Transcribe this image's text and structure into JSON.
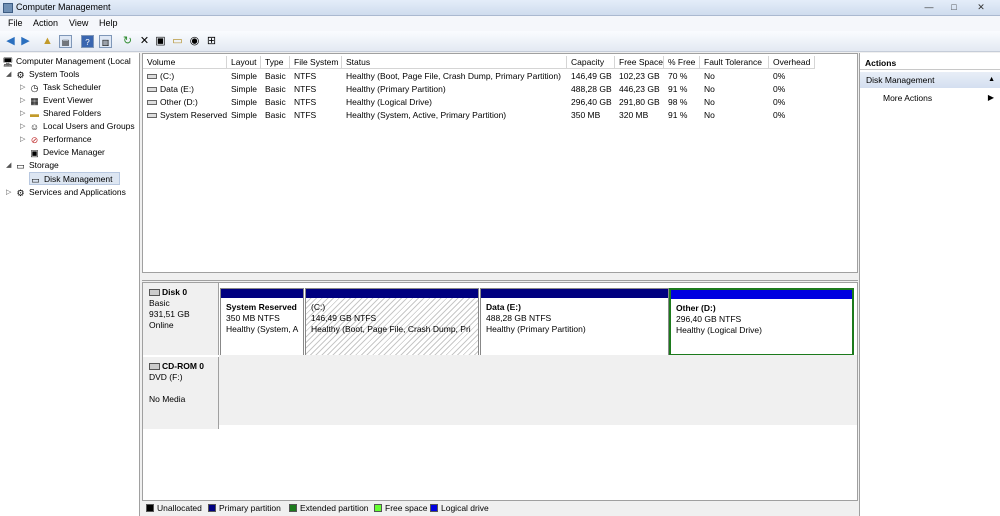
{
  "window": {
    "title": "Computer Management",
    "minimize": "—",
    "maximize": "□",
    "close": "✕"
  },
  "menu": [
    "File",
    "Action",
    "View",
    "Help"
  ],
  "toolbar": {
    "icons": [
      "back-arrow-icon",
      "forward-arrow-icon",
      "up-folder-icon",
      "show-hide-tree-icon",
      "help-icon",
      "show-hide-action-pane-icon",
      "refresh-icon",
      "delete-icon",
      "properties-icon",
      "open-icon",
      "search-icon",
      "zoom-icon"
    ]
  },
  "tree": {
    "root": "Computer Management (Local",
    "system_tools": "System Tools",
    "task_scheduler": "Task Scheduler",
    "event_viewer": "Event Viewer",
    "shared_folders": "Shared Folders",
    "local_users": "Local Users and Groups",
    "performance": "Performance",
    "device_manager": "Device Manager",
    "storage": "Storage",
    "disk_management": "Disk Management",
    "services": "Services and Applications"
  },
  "volumes": {
    "headers": [
      "Volume",
      "Layout",
      "Type",
      "File System",
      "Status",
      "Capacity",
      "Free Space",
      "% Free",
      "Fault Tolerance",
      "Overhead"
    ],
    "rows": [
      [
        "(C:)",
        "Simple",
        "Basic",
        "NTFS",
        "Healthy (Boot, Page File, Crash Dump, Primary Partition)",
        "146,49 GB",
        "102,23 GB",
        "70 %",
        "No",
        "0%"
      ],
      [
        "Data (E:)",
        "Simple",
        "Basic",
        "NTFS",
        "Healthy (Primary Partition)",
        "488,28 GB",
        "446,23 GB",
        "91 %",
        "No",
        "0%"
      ],
      [
        "Other (D:)",
        "Simple",
        "Basic",
        "NTFS",
        "Healthy (Logical Drive)",
        "296,40 GB",
        "291,80 GB",
        "98 %",
        "No",
        "0%"
      ],
      [
        "System Reserved",
        "Simple",
        "Basic",
        "NTFS",
        "Healthy (System, Active, Primary Partition)",
        "350 MB",
        "320 MB",
        "91 %",
        "No",
        "0%"
      ]
    ]
  },
  "disk0": {
    "name": "Disk 0",
    "type": "Basic",
    "size": "931,51 GB",
    "state": "Online",
    "partitions": [
      {
        "name": "System Reserved",
        "size": "350 MB NTFS",
        "status": "Healthy (System, A"
      },
      {
        "name": "(C:)",
        "size": "146,49 GB NTFS",
        "status": "Healthy (Boot, Page File, Crash Dump, Pri"
      },
      {
        "name": "Data  (E:)",
        "size": "488,28 GB NTFS",
        "status": "Healthy (Primary Partition)"
      },
      {
        "name": "Other  (D:)",
        "size": "296,40 GB NTFS",
        "status": "Healthy (Logical Drive)"
      }
    ]
  },
  "cdrom0": {
    "name": "CD-ROM 0",
    "drive": "DVD (F:)",
    "media": "No Media"
  },
  "legend": [
    {
      "label": "Unallocated",
      "color": "#000000"
    },
    {
      "label": "Primary partition",
      "color": "#000080"
    },
    {
      "label": "Extended partition",
      "color": "#1c7a1c"
    },
    {
      "label": "Free space",
      "color": "#66ff33"
    },
    {
      "label": "Logical drive",
      "color": "#0000e0"
    }
  ],
  "actions": {
    "title": "Actions",
    "section": "Disk Management",
    "more": "More Actions"
  }
}
